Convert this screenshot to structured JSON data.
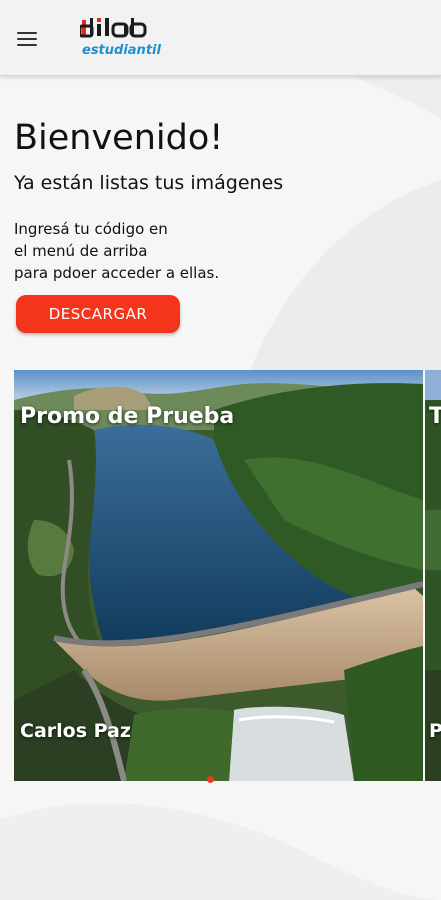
{
  "header": {
    "logo_top": "dilab",
    "logo_bottom": "estudiantil"
  },
  "main": {
    "title": "Bienvenido!",
    "subtitle": "Ya están listas tus imágenes",
    "instructions": [
      "Ingresá tu código en",
      "el menú de arriba",
      "para pdoer acceder a ellas."
    ],
    "download_label": "DESCARGAR"
  },
  "carousel": {
    "slides": [
      {
        "title": "Promo de Prueba",
        "location": "Carlos Paz"
      },
      {
        "title": "T",
        "location": "P"
      }
    ],
    "active_index": 0
  },
  "colors": {
    "accent": "#f5341c",
    "logo_blue": "#1e8fd0",
    "logo_red": "#e02a20"
  },
  "icons": [
    "menu-icon"
  ]
}
